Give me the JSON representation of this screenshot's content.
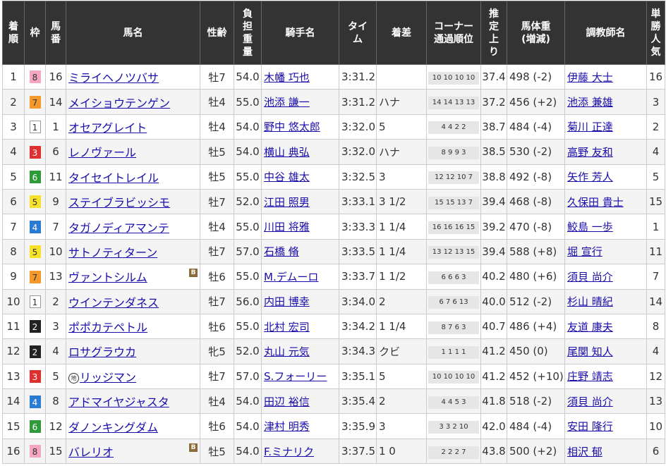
{
  "headers": {
    "rank": [
      "着",
      "順"
    ],
    "waku": "枠",
    "umaban": [
      "馬",
      "番"
    ],
    "horse": "馬名",
    "sexage": "性齢",
    "weight": [
      "負",
      "担",
      "重",
      "量"
    ],
    "jockey": "騎手名",
    "time": [
      "タイ",
      "ム"
    ],
    "margin": "着差",
    "corner": [
      "コーナー",
      "通過順位"
    ],
    "last": [
      "推",
      "定",
      "上",
      "り"
    ],
    "body": [
      "馬体重",
      "(増減)"
    ],
    "trainer": "調教師名",
    "pop": [
      "単",
      "勝",
      "人",
      "気"
    ]
  },
  "colors": {
    "header_bg": "#333333",
    "link": "#1a0dab",
    "row_alt": "#f4f4f4",
    "waku": {
      "1": {
        "bg": "#ffffff",
        "fg": "#333333",
        "border": "#999999"
      },
      "2": {
        "bg": "#222222",
        "fg": "#ffffff",
        "border": "#222222"
      },
      "3": {
        "bg": "#e02f2f",
        "fg": "#ffffff",
        "border": "#e02f2f"
      },
      "4": {
        "bg": "#2a7bd4",
        "fg": "#ffffff",
        "border": "#2a7bd4"
      },
      "5": {
        "bg": "#f7e12a",
        "fg": "#333333",
        "border": "#f7e12a"
      },
      "6": {
        "bg": "#2f9a3a",
        "fg": "#ffffff",
        "border": "#2f9a3a"
      },
      "7": {
        "bg": "#f59a2a",
        "fg": "#333333",
        "border": "#f59a2a"
      },
      "8": {
        "bg": "#f5a6c0",
        "fg": "#333333",
        "border": "#f5a6c0"
      }
    }
  },
  "rows": [
    {
      "rank": "1",
      "waku": "8",
      "umaban": "16",
      "horse": "ミライヘノツバサ",
      "blink": false,
      "chihou": false,
      "sexage": "牡7",
      "weight": "54.0",
      "jockey": "木幡 巧也",
      "time": "3:31.2",
      "margin": "",
      "corner": "10 10 10 10",
      "last": "37.4",
      "body": "498 (-2)",
      "trainer": "伊藤 大士",
      "pop": "16"
    },
    {
      "rank": "2",
      "waku": "7",
      "umaban": "14",
      "horse": "メイショウテンゲン",
      "blink": false,
      "chihou": false,
      "sexage": "牡4",
      "weight": "55.0",
      "jockey": "池添 謙一",
      "time": "3:31.2",
      "margin": "ハナ",
      "corner": "14 14 13 13",
      "last": "37.2",
      "body": "456 (+2)",
      "trainer": "池添 兼雄",
      "pop": "3"
    },
    {
      "rank": "3",
      "waku": "1",
      "umaban": "1",
      "horse": "オセアグレイト",
      "blink": false,
      "chihou": false,
      "sexage": "牡4",
      "weight": "54.0",
      "jockey": "野中 悠太郎",
      "time": "3:32.0",
      "margin": "5",
      "corner": "4 4 2 2",
      "last": "38.7",
      "body": "484 (-4)",
      "trainer": "菊川 正達",
      "pop": "2"
    },
    {
      "rank": "4",
      "waku": "3",
      "umaban": "6",
      "horse": "レノヴァール",
      "blink": false,
      "chihou": false,
      "sexage": "牡5",
      "weight": "54.0",
      "jockey": "横山 典弘",
      "time": "3:32.0",
      "margin": "ハナ",
      "corner": "8 9 9 3",
      "last": "38.5",
      "body": "530 (-2)",
      "trainer": "高野 友和",
      "pop": "4"
    },
    {
      "rank": "5",
      "waku": "6",
      "umaban": "11",
      "horse": "タイセイトレイル",
      "blink": false,
      "chihou": false,
      "sexage": "牡5",
      "weight": "55.0",
      "jockey": "中谷 雄太",
      "time": "3:32.5",
      "margin": "3",
      "corner": "12 12 10 7",
      "last": "38.8",
      "body": "492 (-8)",
      "trainer": "矢作 芳人",
      "pop": "5"
    },
    {
      "rank": "6",
      "waku": "5",
      "umaban": "9",
      "horse": "ステイブラビッシモ",
      "blink": false,
      "chihou": false,
      "sexage": "牡7",
      "weight": "52.0",
      "jockey": "江田 照男",
      "time": "3:33.1",
      "margin": "3 1/2",
      "corner": "15 15 13 7",
      "last": "39.4",
      "body": "468 (-8)",
      "trainer": "久保田 貴士",
      "pop": "15"
    },
    {
      "rank": "7",
      "waku": "4",
      "umaban": "7",
      "horse": "タガノディアマンテ",
      "blink": false,
      "chihou": false,
      "sexage": "牡4",
      "weight": "55.0",
      "jockey": "川田 将雅",
      "time": "3:33.3",
      "margin": "1 1/4",
      "corner": "16 16 16 15",
      "last": "39.2",
      "body": "470 (-8)",
      "trainer": "鮫島 一歩",
      "pop": "1"
    },
    {
      "rank": "8",
      "waku": "5",
      "umaban": "10",
      "horse": "サトノティターン",
      "blink": false,
      "chihou": false,
      "sexage": "牡7",
      "weight": "57.0",
      "jockey": "石橋 脩",
      "time": "3:33.5",
      "margin": "1 1/4",
      "corner": "13 12 13 15",
      "last": "39.4",
      "body": "588 (+8)",
      "trainer": "堀 宣行",
      "pop": "11"
    },
    {
      "rank": "9",
      "waku": "7",
      "umaban": "13",
      "horse": "ヴァントシルム",
      "blink": true,
      "chihou": false,
      "sexage": "牡6",
      "weight": "55.0",
      "jockey": "M.デムーロ",
      "time": "3:33.7",
      "margin": "1 1/2",
      "corner": "6 6 6 3",
      "last": "40.2",
      "body": "480 (+6)",
      "trainer": "須貝 尚介",
      "pop": "7"
    },
    {
      "rank": "10",
      "waku": "1",
      "umaban": "2",
      "horse": "ウインテンダネス",
      "blink": false,
      "chihou": false,
      "sexage": "牡7",
      "weight": "56.0",
      "jockey": "内田 博幸",
      "time": "3:34.0",
      "margin": "2",
      "corner": "6 7 6 13",
      "last": "40.0",
      "body": "512 (-2)",
      "trainer": "杉山 晴紀",
      "pop": "14"
    },
    {
      "rank": "11",
      "waku": "2",
      "umaban": "3",
      "horse": "ポポカテペトル",
      "blink": false,
      "chihou": false,
      "sexage": "牡6",
      "weight": "55.0",
      "jockey": "北村 宏司",
      "time": "3:34.2",
      "margin": "1 1/4",
      "corner": "8 7 6 3",
      "last": "40.7",
      "body": "486 (+4)",
      "trainer": "友道 康夫",
      "pop": "8"
    },
    {
      "rank": "12",
      "waku": "2",
      "umaban": "4",
      "horse": "ロサグラウカ",
      "blink": false,
      "chihou": false,
      "sexage": "牝5",
      "weight": "52.0",
      "jockey": "丸山 元気",
      "time": "3:34.3",
      "margin": "クビ",
      "corner": "1 1 1 1",
      "last": "41.2",
      "body": "450 (0)",
      "trainer": "尾関 知人",
      "pop": "4"
    },
    {
      "rank": "13",
      "waku": "3",
      "umaban": "5",
      "horse": "リッジマン",
      "blink": false,
      "chihou": true,
      "sexage": "牡7",
      "weight": "57.0",
      "jockey": "S.フォーリー",
      "time": "3:35.1",
      "margin": "5",
      "corner": "10 10 10 10",
      "last": "41.2",
      "body": "452 (+10)",
      "trainer": "庄野 靖志",
      "pop": "12"
    },
    {
      "rank": "14",
      "waku": "4",
      "umaban": "8",
      "horse": "アドマイヤジャスタ",
      "blink": false,
      "chihou": false,
      "sexage": "牡4",
      "weight": "54.0",
      "jockey": "田辺 裕信",
      "time": "3:35.4",
      "margin": "2",
      "corner": "4 4 5 3",
      "last": "41.8",
      "body": "518 (-2)",
      "trainer": "須貝 尚介",
      "pop": "13"
    },
    {
      "rank": "15",
      "waku": "6",
      "umaban": "12",
      "horse": "ダノンキングダム",
      "blink": false,
      "chihou": false,
      "sexage": "牡6",
      "weight": "54.0",
      "jockey": "津村 明秀",
      "time": "3:35.9",
      "margin": "3",
      "corner": "3 3 2 10",
      "last": "42.0",
      "body": "484 (-4)",
      "trainer": "安田 隆行",
      "pop": "10"
    },
    {
      "rank": "16",
      "waku": "8",
      "umaban": "15",
      "horse": "バレリオ",
      "blink": true,
      "chihou": false,
      "sexage": "牡5",
      "weight": "54.0",
      "jockey": "F.ミナリク",
      "time": "3:37.5",
      "margin": "1 0",
      "corner": "2 2 2 7",
      "last": "43.8",
      "body": "500 (+2)",
      "trainer": "相沢 郁",
      "pop": "6"
    }
  ],
  "badges": {
    "blinker": "B",
    "chihou": "地"
  }
}
